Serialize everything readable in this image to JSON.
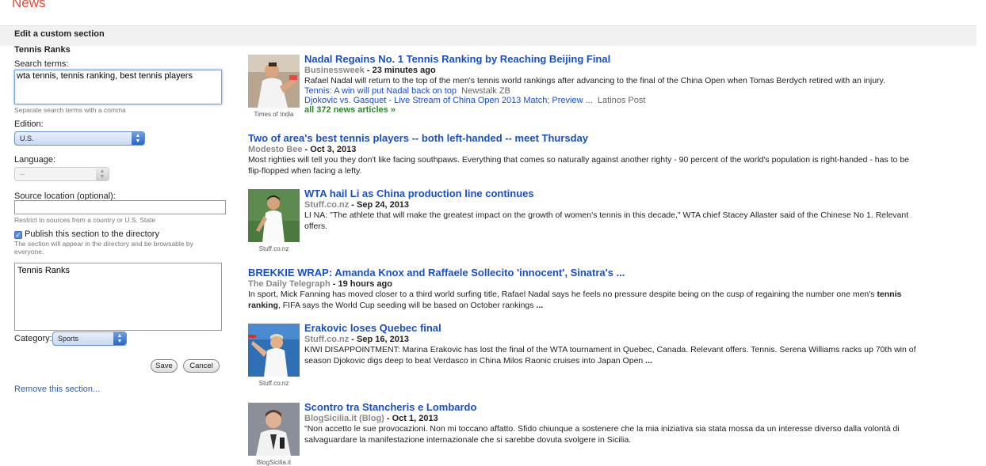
{
  "app": {
    "title": "News"
  },
  "header": {
    "label": "Edit a custom section"
  },
  "form": {
    "section_name": "Tennis Ranks",
    "search_label": "Search terms:",
    "search_value": "wta tennis, tennis ranking, best tennis players",
    "search_help": "Separate search terms with a comma",
    "edition_label": "Edition:",
    "edition_value": "U.S.",
    "language_label": "Language:",
    "language_value": "--",
    "source_label": "Source location (optional):",
    "source_value": "",
    "source_help": "Restrict to sources from a country or U.S. State",
    "publish_label": "Publish this section to the directory",
    "publish_checked": true,
    "publish_help": "The section will appear in the directory and be browsable by everyone.",
    "description_value": "Tennis Ranks",
    "category_label": "Category:",
    "category_value": "Sports",
    "save_label": "Save",
    "cancel_label": "Cancel",
    "remove_label": "Remove this section..."
  },
  "articles": [
    {
      "headline": "Nadal Regains No. 1 Tennis Ranking by Reaching Beijing Final",
      "publisher": "Businessweek",
      "time": " - 23 minutes ago",
      "snippet": "Rafael Nadal will return to the top of the men's tennis world rankings after advancing to the final of the China Open when Tomas Berdych retired with an injury.",
      "thumb_source": "Times of India",
      "related": [
        {
          "title": "Tennis: A win will put Nadal back on top",
          "source": "Newstalk ZB"
        },
        {
          "title": "Djokovic vs. Gasquet - Live Stream of China Open 2013 Match; Preview ...",
          "source": "Latinos Post"
        }
      ],
      "all_link": "all 372 news articles »"
    },
    {
      "headline": "Two of area's best tennis players -- both left-handed -- meet Thursday",
      "publisher": "Modesto Bee",
      "time": " - Oct 3, 2013",
      "snippet_line1": "Most righties will tell you they don't like facing southpaws. Everything that comes so naturally against another righty - 90 percent of the world's population is right-handed - has to be",
      "snippet_line2": "flip-flopped when facing a lefty."
    },
    {
      "headline": "WTA hail Li as China production line continues",
      "publisher": "Stuff.co.nz",
      "time": " - Sep 24, 2013",
      "snippet_line1": "LI NA: \"The athlete that will make the greatest impact on the growth of women's tennis in this decade,\" WTA chief Stacey Allaster said of the Chinese No 1. Relevant",
      "snippet_line2": "offers.",
      "thumb_source": "Stuff.co.nz"
    },
    {
      "headline": "BREKKIE WRAP: Amanda Knox and Raffaele Sollecito 'innocent', Sinatra's ...",
      "publisher": "The Daily Telegraph",
      "time": " - 19 hours ago",
      "snippet_pre": "In sport, Mick Fanning has moved closer to a third world surfing title, Rafael Nadal says he feels no pressure despite being on the cusp of regaining the number one men's ",
      "snippet_bold1": "tennis",
      "snippet_bold2": "ranking",
      "snippet_post": ", FIFA says the World Cup seeding will be based on October rankings ",
      "snippet_ellipsis": "..."
    },
    {
      "headline": "Erakovic loses Quebec final",
      "publisher": "Stuff.co.nz",
      "time": " - Sep 16, 2013",
      "snippet_line1": "KIWI DISAPPOINTMENT: Marina Erakovic has lost the final of the WTA tournament in Quebec, Canada. Relevant offers. Tennis. Serena Williams racks up 70th win of",
      "snippet_line2": "season Djokovic digs deep to beat Verdasco in China Milos Raonic cruises into Japan Open ",
      "snippet_ellipsis": "...",
      "thumb_source": "Stuff.co.nz"
    },
    {
      "headline": "Scontro tra Stancheris e Lombardo",
      "publisher": "BlogSicilia.it (Blog)",
      "time": " - Oct 1, 2013",
      "snippet_line1": "\"Non accetto le sue provocazioni. Non mi toccano affatto. Sfido chiunque a sostenere che la mia iniziativa sia stata mossa da un interesse diverso dalla volontà di",
      "snippet_line2": "salvaguardare la manifestazione internazionale che si sarebbe dovuta svolgere in Sicilia.",
      "thumb_source": "BlogSicilia.it"
    }
  ]
}
